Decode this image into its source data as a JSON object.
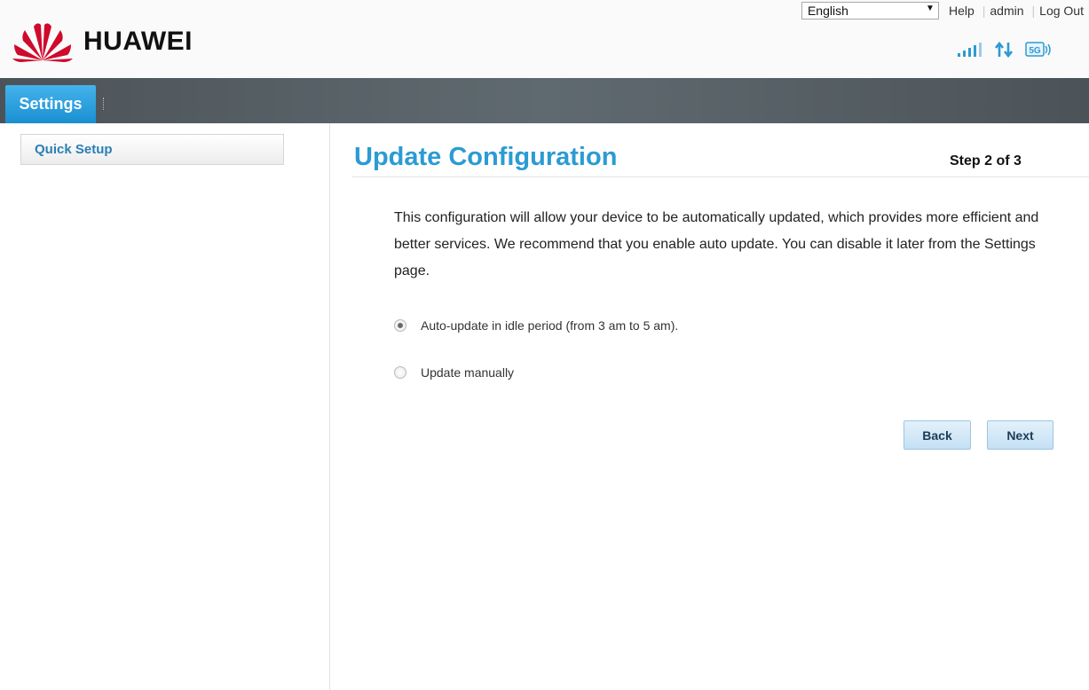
{
  "brand": {
    "name": "HUAWEI",
    "logo_color": "#cf0a2c"
  },
  "top_bar": {
    "language": "English",
    "links": [
      "Help",
      "admin",
      "Log Out"
    ]
  },
  "status": {
    "icons": [
      "signal-strength-icon",
      "data-transfer-icon",
      "5g-network-icon"
    ],
    "network_label": "5G"
  },
  "nav": {
    "active_tab": "Settings",
    "accent": "#2b9bd3"
  },
  "sidebar": {
    "items": [
      {
        "label": "Quick Setup"
      }
    ]
  },
  "main": {
    "title": "Update Configuration",
    "step": "Step 2 of 3",
    "description": "This configuration will allow your device to be automatically updated, which provides more efficient and better services. We recommend that you enable auto update. You can disable it later from the Settings page.",
    "options": [
      {
        "label": "Auto-update in idle period (from 3 am to 5 am).",
        "selected": true
      },
      {
        "label": "Update manually",
        "selected": false
      }
    ],
    "buttons": {
      "back": "Back",
      "next": "Next"
    }
  }
}
